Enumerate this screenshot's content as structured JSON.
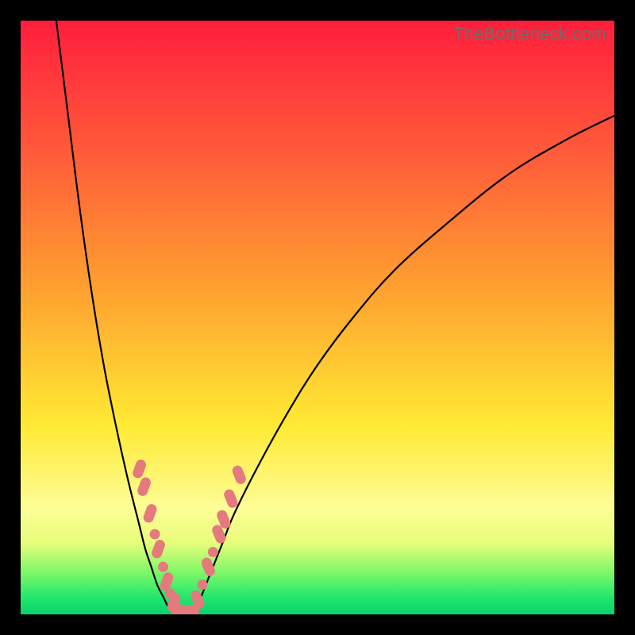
{
  "watermark": "TheBottleneck.com",
  "chart_data": {
    "type": "line",
    "title": "",
    "xlabel": "",
    "ylabel": "",
    "xlim": [
      0,
      100
    ],
    "ylim": [
      0,
      100
    ],
    "legend": false,
    "grid": false,
    "background_gradient_stops": [
      {
        "pos": 0,
        "color": "#ff1e3c"
      },
      {
        "pos": 22,
        "color": "#ff5a3a"
      },
      {
        "pos": 45,
        "color": "#ffa030"
      },
      {
        "pos": 68,
        "color": "#ffe933"
      },
      {
        "pos": 82,
        "color": "#fdfd96"
      },
      {
        "pos": 88,
        "color": "#e7fd7a"
      },
      {
        "pos": 93,
        "color": "#7cf768"
      },
      {
        "pos": 97,
        "color": "#24e86b"
      },
      {
        "pos": 100,
        "color": "#07d36c"
      }
    ],
    "series": [
      {
        "name": "left-curve",
        "x": [
          6,
          8,
          10,
          12,
          14,
          16,
          18,
          20,
          21,
          22,
          23,
          24,
          25,
          26
        ],
        "y": [
          100,
          84,
          68,
          54,
          42,
          32,
          23,
          15,
          11,
          8,
          5,
          3,
          1,
          0
        ]
      },
      {
        "name": "right-curve",
        "x": [
          29,
          30,
          32,
          34,
          36,
          40,
          45,
          50,
          56,
          63,
          72,
          82,
          92,
          100
        ],
        "y": [
          0,
          2,
          7,
          12,
          17,
          25,
          34,
          42,
          50,
          58,
          66,
          74,
          80,
          84
        ]
      }
    ],
    "highlight_points": {
      "name": "pink-dots",
      "color": "#e57a7e",
      "points": [
        {
          "x": 20.0,
          "y": 24.5,
          "shape": "pill-slash-left"
        },
        {
          "x": 20.8,
          "y": 21.5,
          "shape": "pill-slash-left"
        },
        {
          "x": 21.8,
          "y": 17.0,
          "shape": "pill-slash-left"
        },
        {
          "x": 22.6,
          "y": 13.5,
          "shape": "dot"
        },
        {
          "x": 23.2,
          "y": 11.0,
          "shape": "pill-slash-left"
        },
        {
          "x": 24.0,
          "y": 8.0,
          "shape": "dot"
        },
        {
          "x": 24.6,
          "y": 5.5,
          "shape": "pill-slash-left"
        },
        {
          "x": 25.2,
          "y": 3.5,
          "shape": "dot"
        },
        {
          "x": 25.8,
          "y": 2.0,
          "shape": "pill-slash-left"
        },
        {
          "x": 26.6,
          "y": 0.8,
          "shape": "pill-horiz"
        },
        {
          "x": 27.6,
          "y": 0.4,
          "shape": "pill-horiz"
        },
        {
          "x": 28.6,
          "y": 0.6,
          "shape": "pill-horiz"
        },
        {
          "x": 29.8,
          "y": 2.5,
          "shape": "pill-slash-right"
        },
        {
          "x": 30.6,
          "y": 5.0,
          "shape": "dot"
        },
        {
          "x": 31.6,
          "y": 8.0,
          "shape": "pill-slash-right"
        },
        {
          "x": 32.4,
          "y": 10.5,
          "shape": "dot"
        },
        {
          "x": 33.4,
          "y": 13.5,
          "shape": "pill-slash-right"
        },
        {
          "x": 34.2,
          "y": 16.0,
          "shape": "pill-slash-right"
        },
        {
          "x": 35.4,
          "y": 19.5,
          "shape": "pill-slash-right"
        },
        {
          "x": 36.8,
          "y": 23.5,
          "shape": "pill-slash-right"
        }
      ]
    }
  }
}
